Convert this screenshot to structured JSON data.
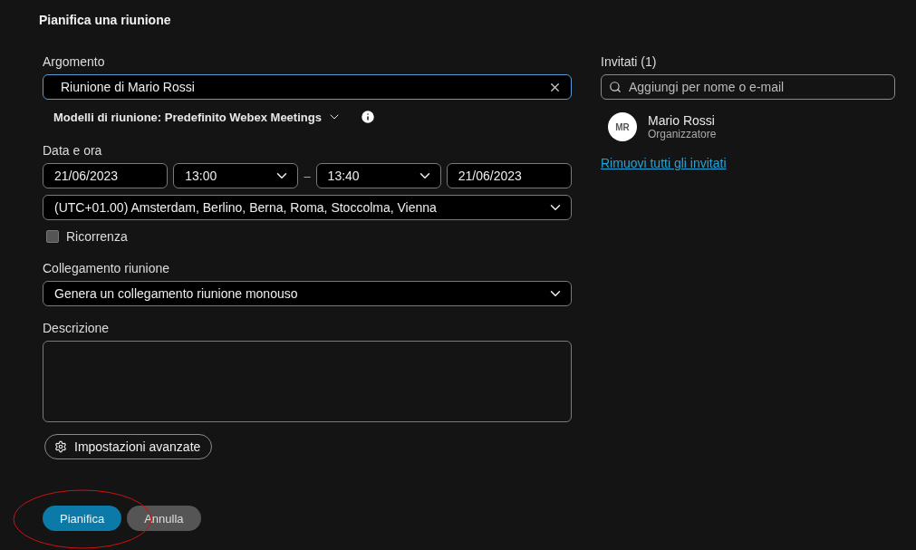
{
  "dialog": {
    "title": "Pianifica una riunione"
  },
  "topic": {
    "label": "Argomento",
    "value": "Riunione di Mario Rossi"
  },
  "template": {
    "text": "Modelli di riunione: Predefinito Webex Meetings"
  },
  "date_time": {
    "label": "Data e ora",
    "start_date": "21/06/2023",
    "start_time": "13:00",
    "separator": "–",
    "end_time": "13:40",
    "end_date": "21/06/2023",
    "timezone": "(UTC+01.00) Amsterdam, Berlino, Berna, Roma, Stoccolma, Vienna"
  },
  "recurrence": {
    "label": "Ricorrenza",
    "checked": false
  },
  "meeting_link": {
    "label": "Collegamento riunione",
    "value": "Genera un collegamento riunione monouso"
  },
  "description": {
    "label": "Descrizione"
  },
  "advanced_button": "Impostazioni avanzate",
  "actions": [
    {
      "label": "Pianifica",
      "kind": "primary"
    },
    {
      "label": "Annulla",
      "kind": "secondary"
    }
  ],
  "invitees": {
    "title": "Invitati (1)",
    "search_placeholder": "Aggiungi per nome o e-mail",
    "people": [
      {
        "initials": "MR",
        "name": "Mario Rossi",
        "role": "Organizzatore"
      }
    ],
    "remove_all": "Rimuovi tutti gli invitati"
  }
}
